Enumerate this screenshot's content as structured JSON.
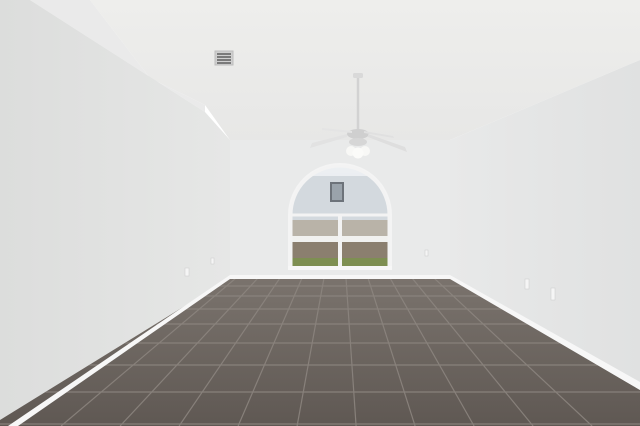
{
  "scene": {
    "description_kind": "empty-room-photo",
    "colors": {
      "wall_left": "#e4e5e4",
      "wall_back": "#e9eaea",
      "wall_right": "#e6e7e7",
      "ceiling": "#ececeb",
      "floor_tile": "#6e6660",
      "grout": "#8d8680",
      "baseboard": "#f7f7f7",
      "window_frame": "#f4f4f4",
      "exterior": "#cfd6db",
      "lawn": "#7e8f52"
    },
    "icons": [
      "ceiling-fan-icon",
      "air-vent-icon",
      "arched-window-icon",
      "power-outlet-icon"
    ]
  }
}
